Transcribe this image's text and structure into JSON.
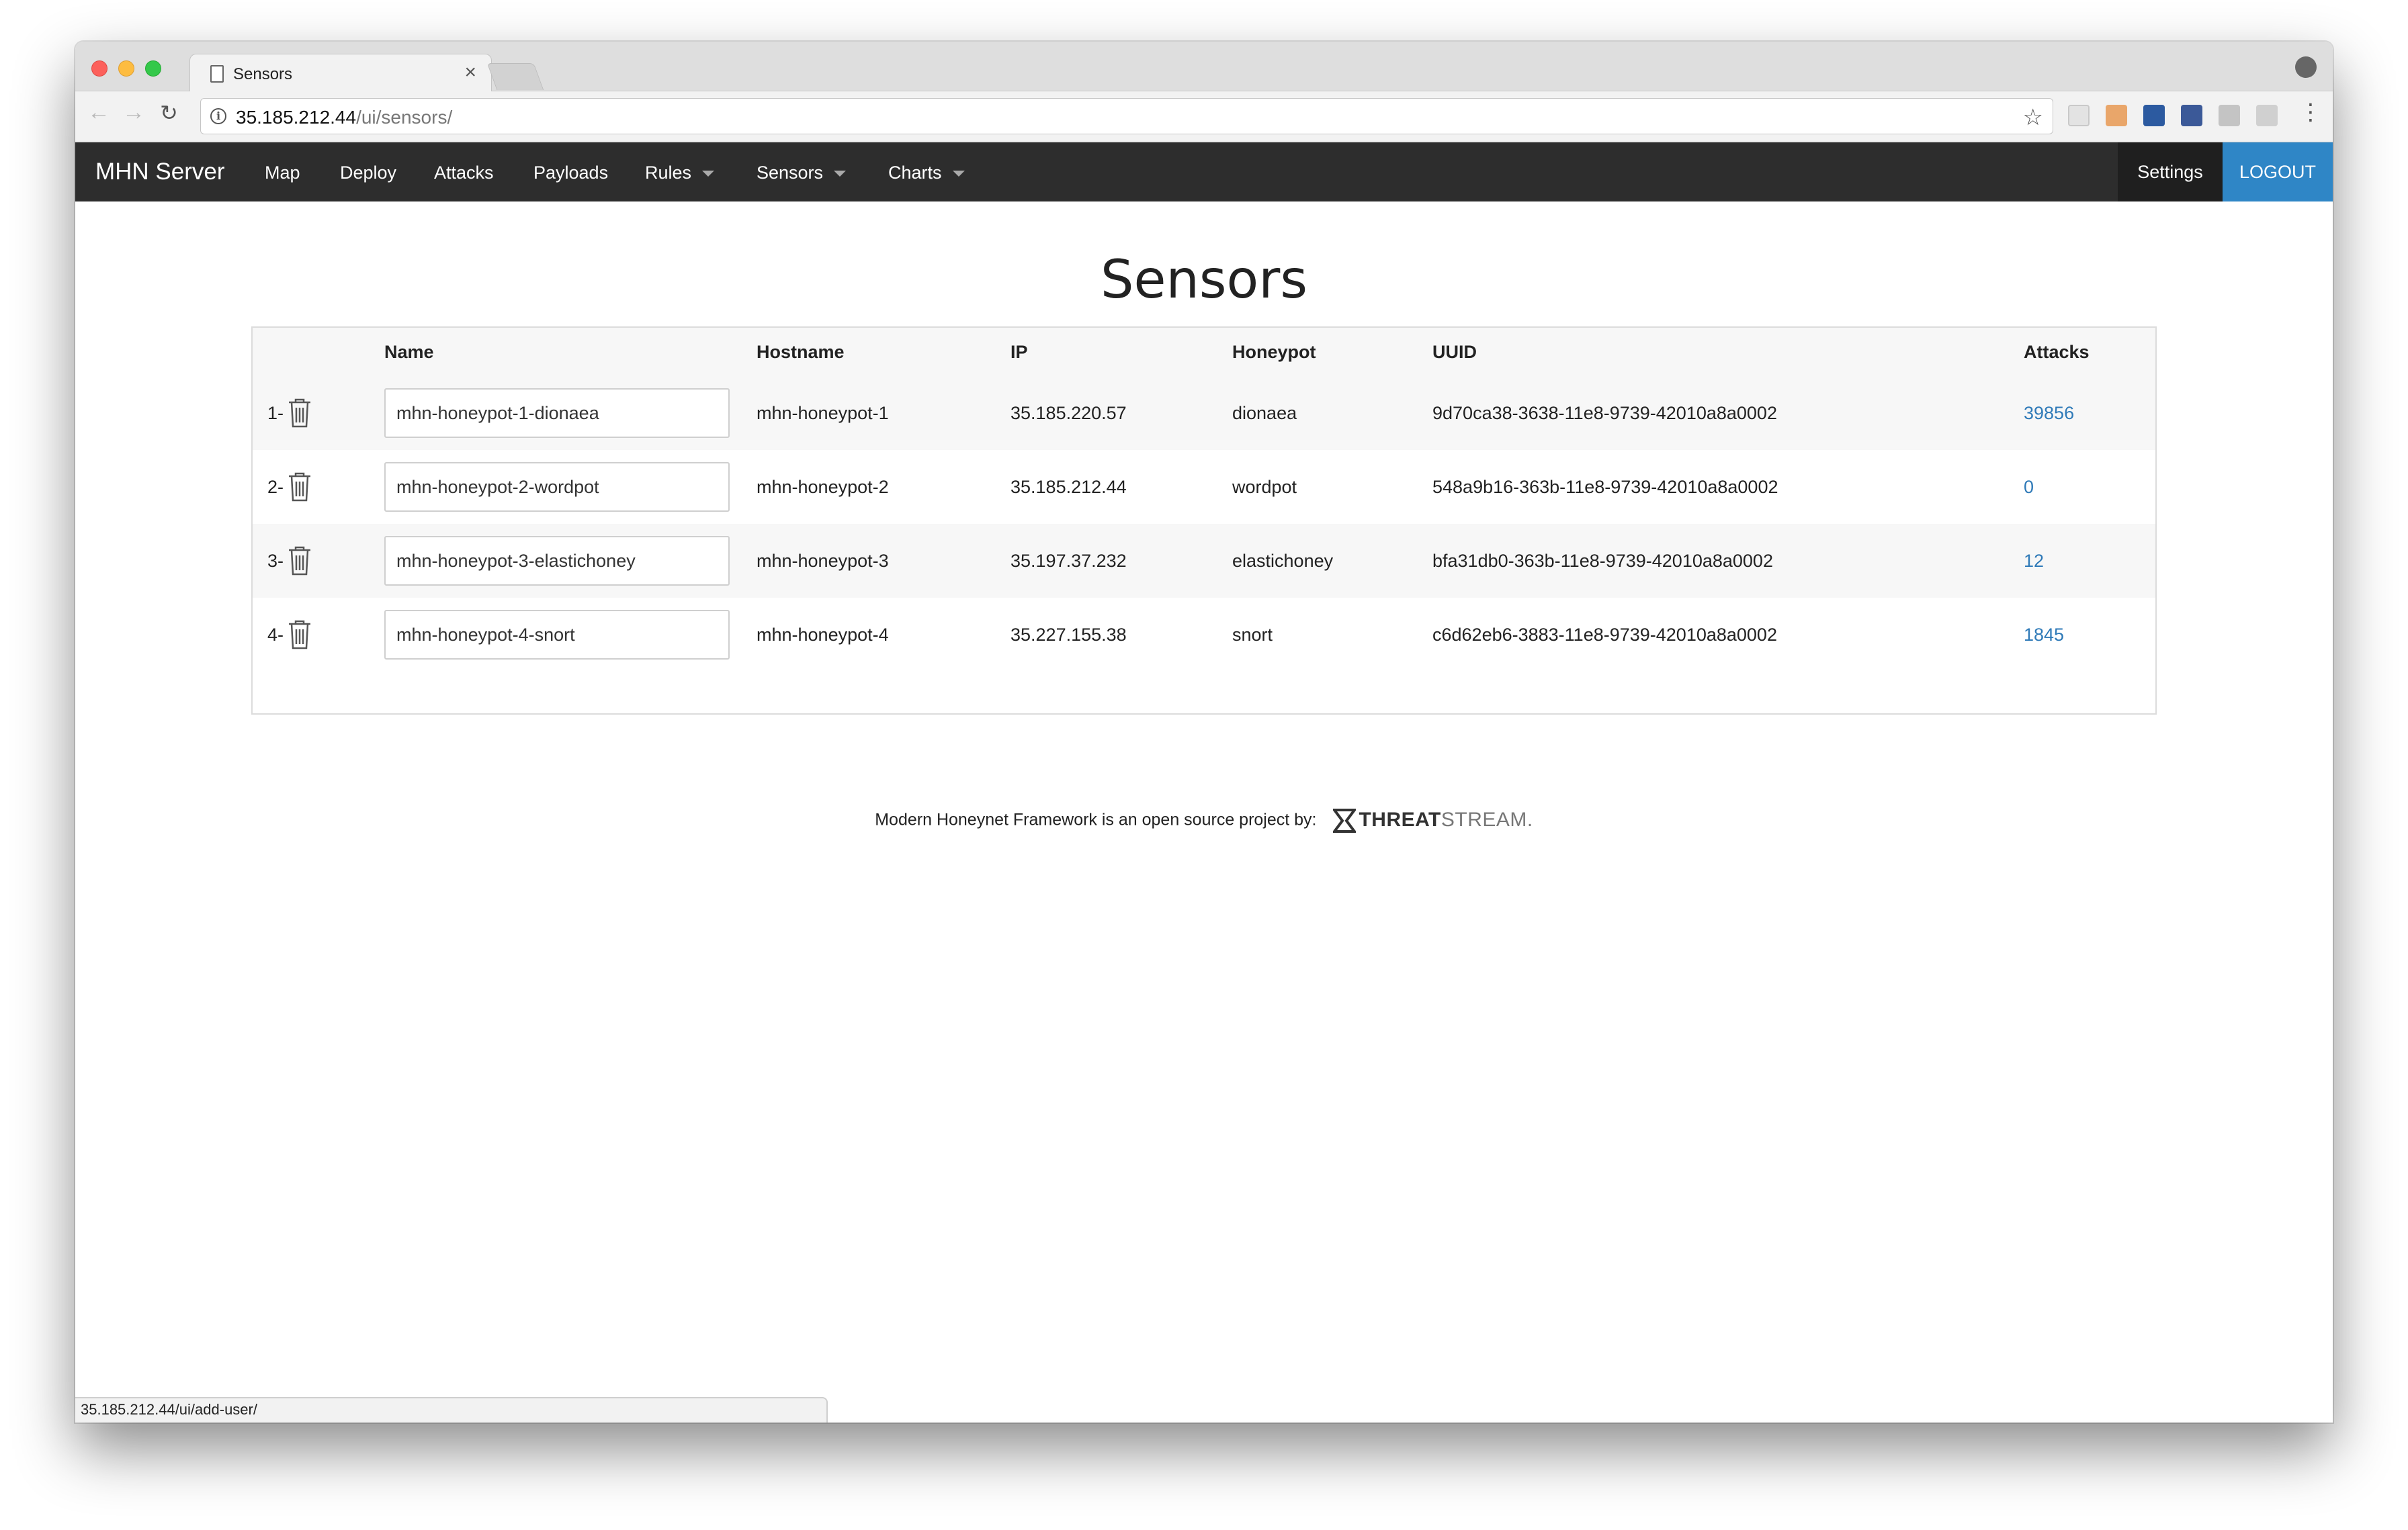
{
  "browser": {
    "tab_title": "Sensors",
    "tab_close": "×",
    "url_host": "35.185.212.44",
    "url_path": "/ui/sensors/",
    "status_url": "35.185.212.44/ui/add-user/"
  },
  "navbar": {
    "brand": "MHN Server",
    "items": [
      {
        "label": "Map",
        "dropdown": false
      },
      {
        "label": "Deploy",
        "dropdown": false
      },
      {
        "label": "Attacks",
        "dropdown": false
      },
      {
        "label": "Payloads",
        "dropdown": false
      },
      {
        "label": "Rules",
        "dropdown": true
      },
      {
        "label": "Sensors",
        "dropdown": true
      },
      {
        "label": "Charts",
        "dropdown": true
      }
    ],
    "settings": "Settings",
    "logout": "LOGOUT"
  },
  "page": {
    "title": "Sensors"
  },
  "table": {
    "headers": [
      "",
      "Name",
      "Hostname",
      "IP",
      "Honeypot",
      "UUID",
      "Attacks"
    ],
    "rows": [
      {
        "index": "1-",
        "name": "mhn-honeypot-1-dionaea",
        "hostname": "mhn-honeypot-1",
        "ip": "35.185.220.57",
        "honeypot": "dionaea",
        "uuid": "9d70ca38-3638-11e8-9739-42010a8a0002",
        "attacks": "39856"
      },
      {
        "index": "2-",
        "name": "mhn-honeypot-2-wordpot",
        "hostname": "mhn-honeypot-2",
        "ip": "35.185.212.44",
        "honeypot": "wordpot",
        "uuid": "548a9b16-363b-11e8-9739-42010a8a0002",
        "attacks": "0"
      },
      {
        "index": "3-",
        "name": "mhn-honeypot-3-elastichoney",
        "hostname": "mhn-honeypot-3",
        "ip": "35.197.37.232",
        "honeypot": "elastichoney",
        "uuid": "bfa31db0-363b-11e8-9739-42010a8a0002",
        "attacks": "12"
      },
      {
        "index": "4-",
        "name": "mhn-honeypot-4-snort",
        "hostname": "mhn-honeypot-4",
        "ip": "35.227.155.38",
        "honeypot": "snort",
        "uuid": "c6d62eb6-3883-11e8-9739-42010a8a0002",
        "attacks": "1845"
      }
    ]
  },
  "footer": {
    "text": "Modern Honeynet Framework is an open source project by:",
    "logo_bold": "THREAT",
    "logo_light": "STREAM."
  },
  "colors": {
    "navbar_bg": "#2d2d2d",
    "logout_bg": "#2f86c6",
    "link": "#2f7ab8"
  }
}
